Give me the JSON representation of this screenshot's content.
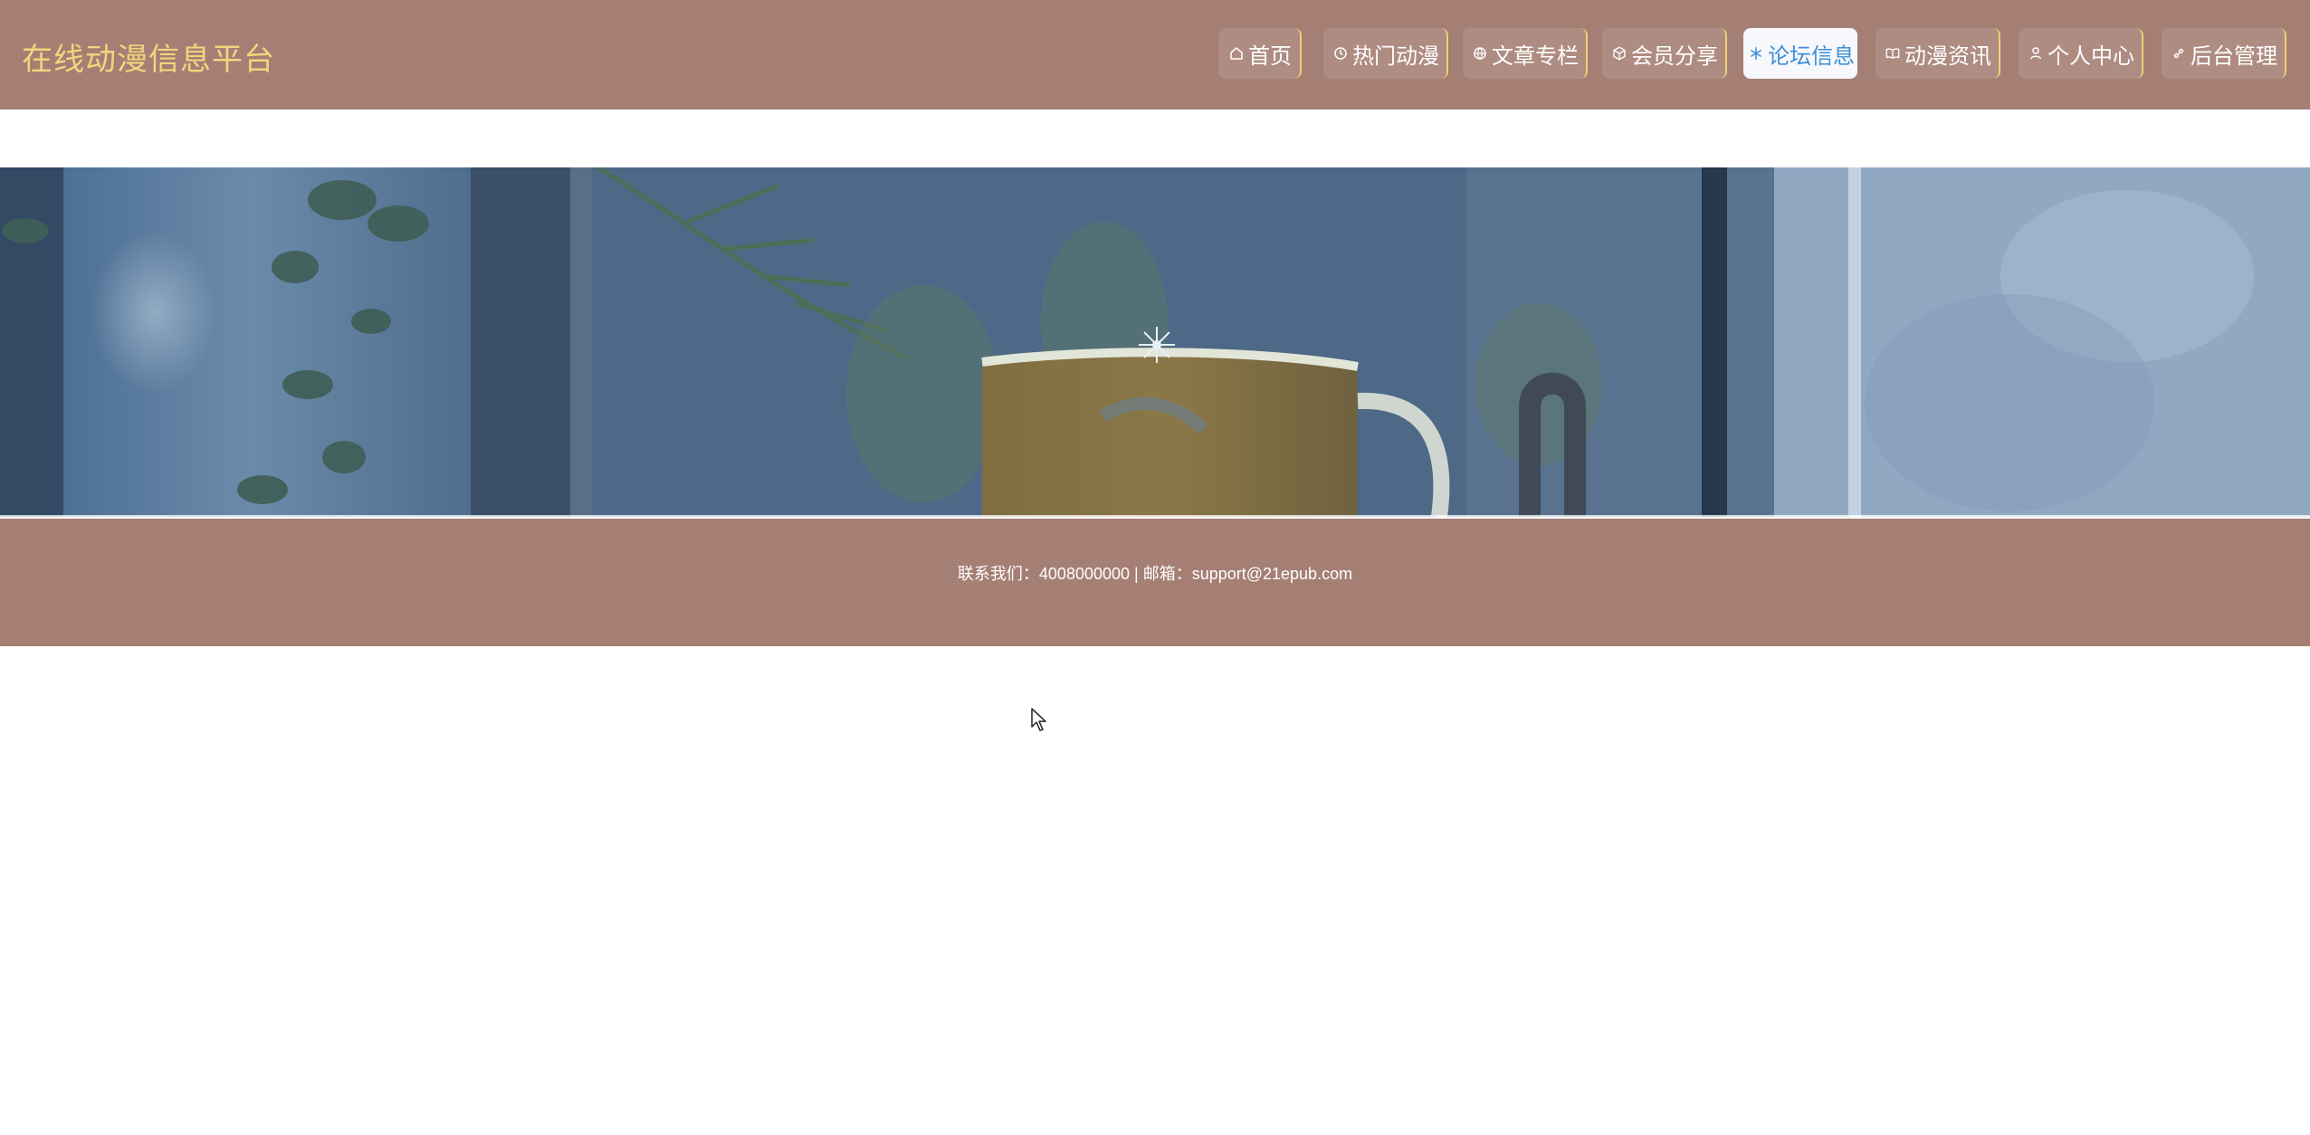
{
  "header": {
    "title": "在线动漫信息平台"
  },
  "nav": {
    "items": [
      {
        "label": "首页",
        "icon": "home-icon"
      },
      {
        "label": "热门动漫",
        "icon": "clock-icon"
      },
      {
        "label": "文章专栏",
        "icon": "globe-icon"
      },
      {
        "label": "会员分享",
        "icon": "box-icon"
      },
      {
        "label": "论坛信息",
        "icon": "snowflake-icon",
        "active": true
      },
      {
        "label": "动漫资讯",
        "icon": "book-icon"
      },
      {
        "label": "个人中心",
        "icon": "user-icon"
      },
      {
        "label": "后台管理",
        "icon": "link-icon"
      }
    ]
  },
  "banner": {
    "scene": "rain-window-plant-mug-icon"
  },
  "footer": {
    "contact": "联系我们：4008000000 | 邮箱：support@21epub.com"
  },
  "colors": {
    "header_bg": "#a57f74",
    "title_color": "#f4d47c",
    "nav_border": "#f2cf72",
    "active_text": "#3f8fd6"
  }
}
